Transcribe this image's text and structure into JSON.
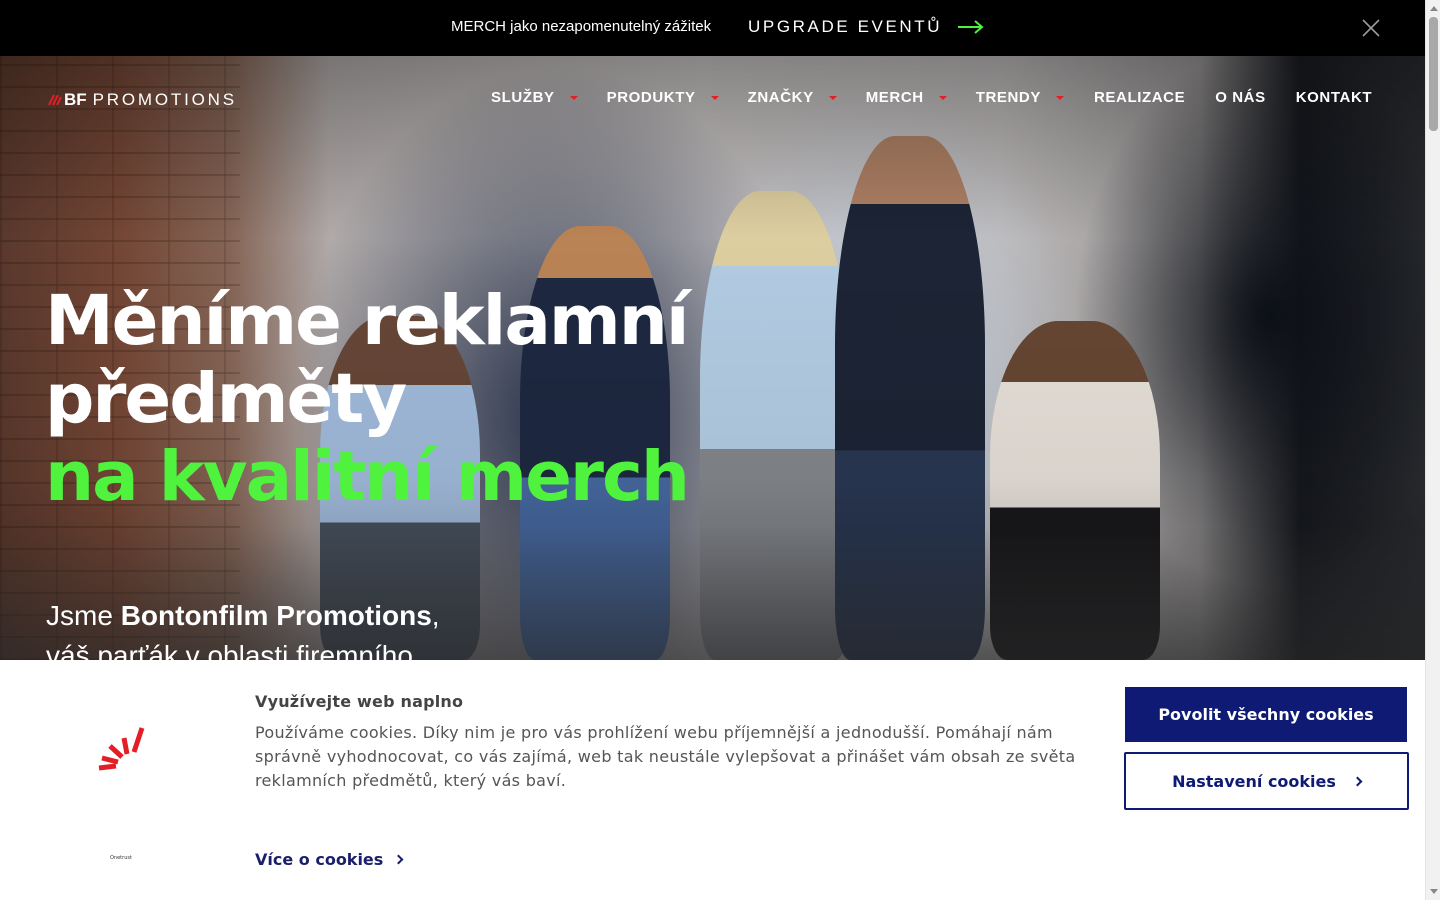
{
  "announcement": {
    "text": "MERCH jako nezapomenutelný zážitek",
    "link_label": "UPGRADE EVENTŮ",
    "arrow_color": "#4ff23d"
  },
  "brand": {
    "bf": "BF",
    "promotions": "PROMOTIONS",
    "accent": "#e31e24"
  },
  "nav": {
    "items": [
      {
        "label": "SLUŽBY",
        "dropdown": true
      },
      {
        "label": "PRODUKTY",
        "dropdown": true
      },
      {
        "label": "ZNAČKY",
        "dropdown": true
      },
      {
        "label": "MERCH",
        "dropdown": true
      },
      {
        "label": "TRENDY",
        "dropdown": true
      },
      {
        "label": "REALIZACE",
        "dropdown": false
      },
      {
        "label": "O NÁS",
        "dropdown": false
      },
      {
        "label": "KONTAKT",
        "dropdown": false
      }
    ]
  },
  "hero": {
    "headline_line1": "Měníme reklamní",
    "headline_line2": "předměty",
    "headline_line3": "na kvalitní merch",
    "highlight_color": "#4ff23d",
    "sub_prefix": "Jsme ",
    "sub_brand": "Bontonfilm Promotions",
    "sub_suffix": ",",
    "sub_line2": "váš parťák v oblasti firemního"
  },
  "cookie_banner": {
    "title": "Využívejte web naplno",
    "body": "Používáme cookies. Díky nim je pro vás prohlížení webu příjemnější a jednodušší. Pomáhají nám správně vyhodnocovat, co vás zajímá, web tak neustále vylepšovat a přinášet vám obsah ze světa reklamních předmětů, který vás baví.",
    "more_link": "Více o cookies",
    "accept_button": "Povolit všechny cookies",
    "settings_button": "Nastavení cookies",
    "powered_by": "Onetrust",
    "button_color": "#0e1a73"
  }
}
